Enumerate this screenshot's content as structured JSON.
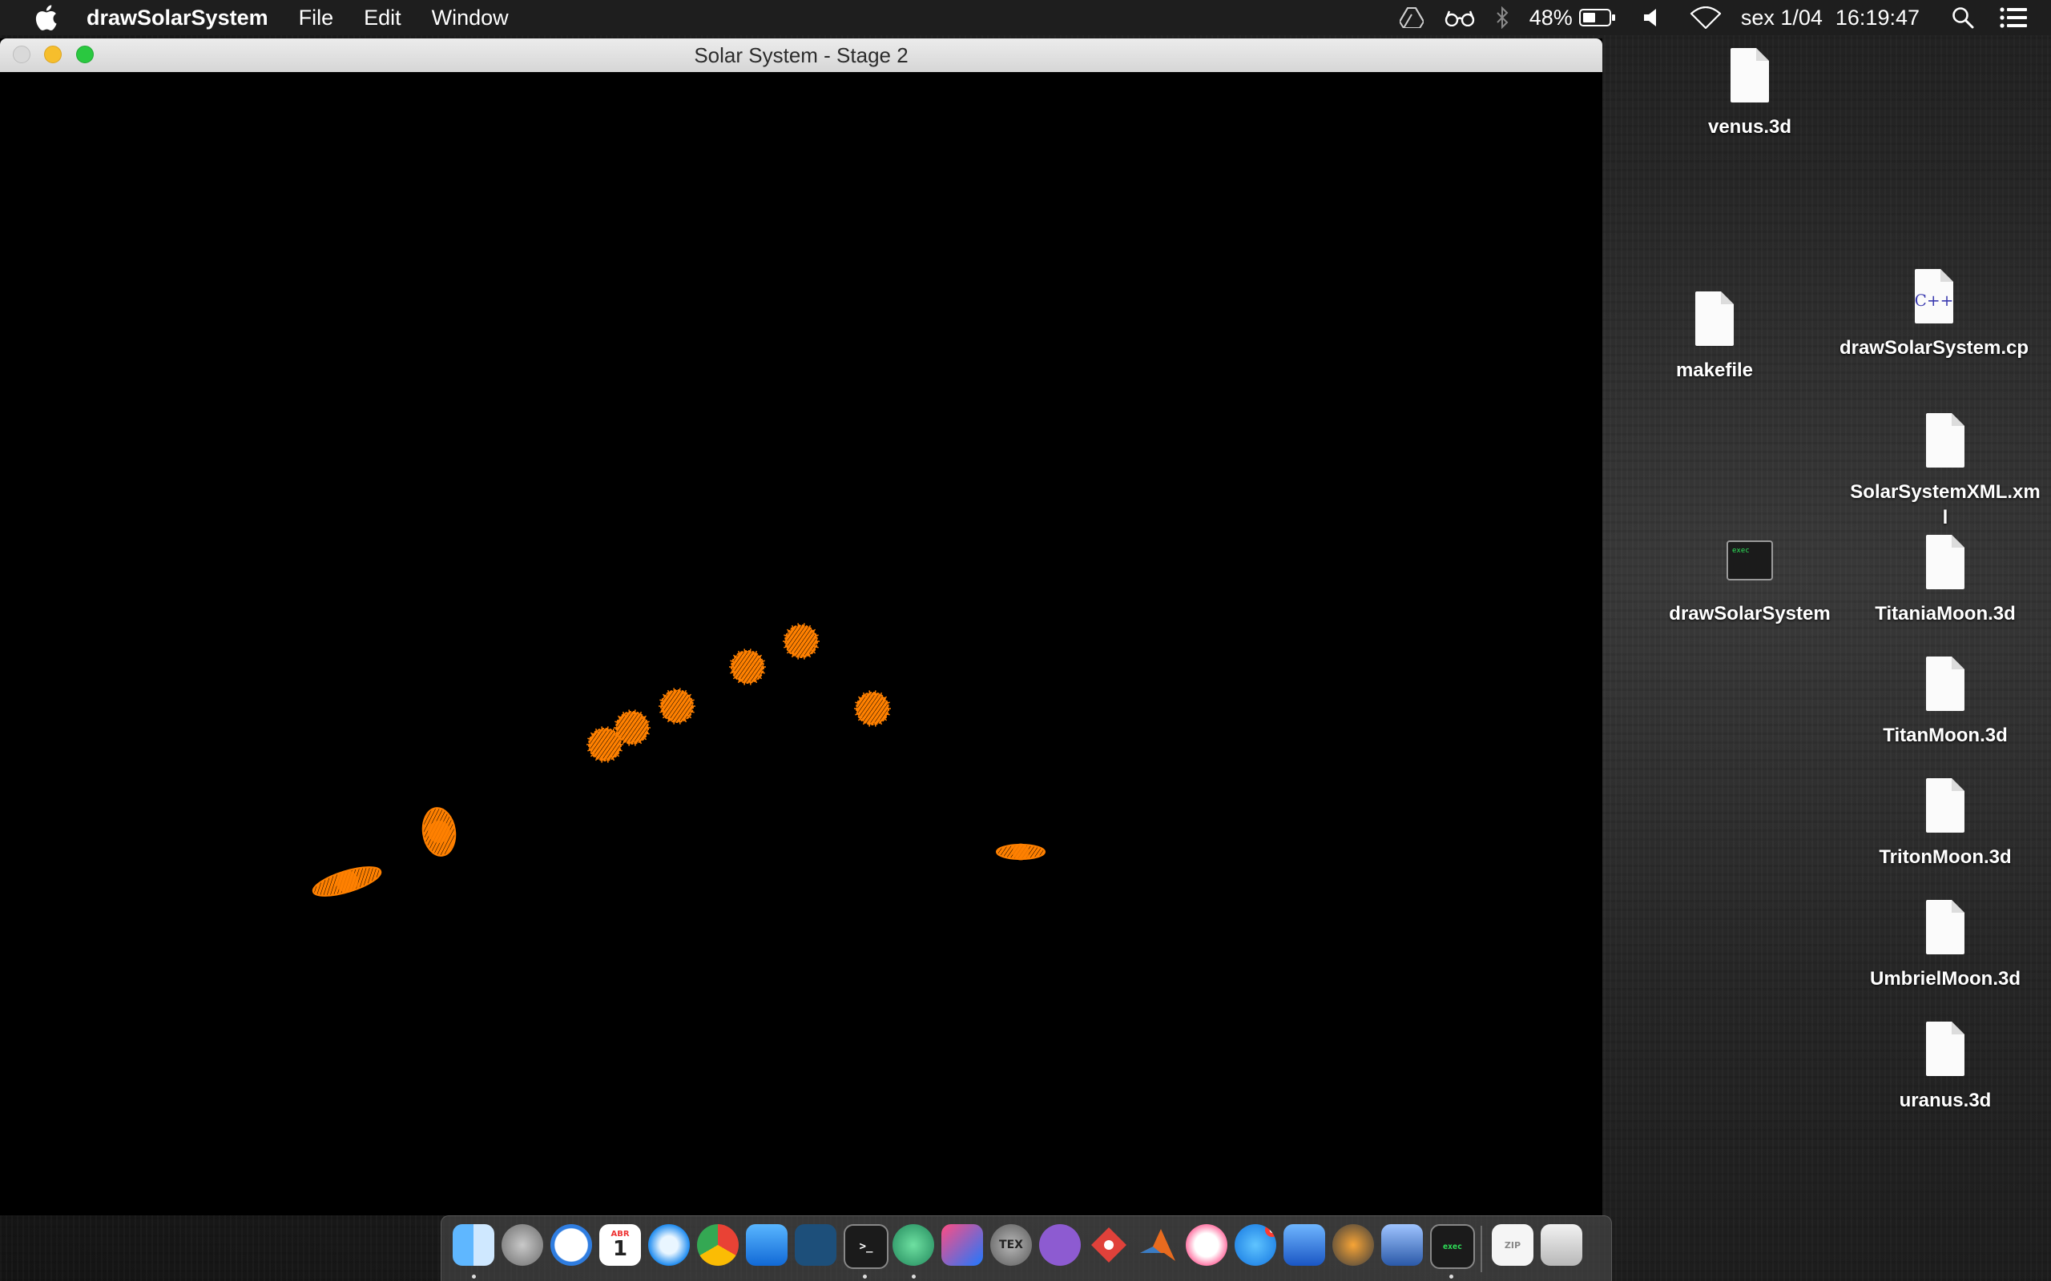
{
  "menubar": {
    "app_name": "drawSolarSystem",
    "items": [
      "File",
      "Edit",
      "Window"
    ],
    "battery_percent": "48%",
    "date": "sex 1/04",
    "time": "16:19:47",
    "icons": [
      "apple-icon",
      "drive-icon",
      "glasses-icon",
      "bluetooth-icon",
      "battery-icon",
      "volume-icon",
      "wifi-icon",
      "spotlight-icon",
      "notification-center-icon"
    ]
  },
  "window": {
    "title": "Solar System - Stage 2",
    "render": {
      "background": "#000000",
      "body_color": "#ff8000",
      "bodies": [
        {
          "kind": "ringed",
          "name": "left-ringed-planet"
        },
        {
          "kind": "ringed-vertical",
          "name": "tilted-planet"
        },
        {
          "kind": "sphere",
          "name": "planet-1"
        },
        {
          "kind": "sphere",
          "name": "planet-2"
        },
        {
          "kind": "sphere",
          "name": "planet-3"
        },
        {
          "kind": "sphere",
          "name": "planet-4"
        },
        {
          "kind": "sphere",
          "name": "planet-5"
        },
        {
          "kind": "sphere",
          "name": "planet-6"
        },
        {
          "kind": "ringed",
          "name": "right-ringed-planet"
        }
      ]
    }
  },
  "desktop": {
    "files": [
      {
        "name": "venus.3d",
        "icon": "document-icon"
      },
      {
        "name": "makefile",
        "icon": "document-icon"
      },
      {
        "name": "drawSolarSystem.cp",
        "icon": "cpp-file-icon"
      },
      {
        "name": "SolarSystemXML.xml",
        "icon": "document-icon"
      },
      {
        "name": "drawSolarSystem",
        "icon": "executable-icon"
      },
      {
        "name": "TitaniaMoon.3d",
        "icon": "document-icon"
      },
      {
        "name": "TitanMoon.3d",
        "icon": "document-icon"
      },
      {
        "name": "TritonMoon.3d",
        "icon": "document-icon"
      },
      {
        "name": "UmbrielMoon.3d",
        "icon": "document-icon"
      },
      {
        "name": "uranus.3d",
        "icon": "document-icon"
      }
    ]
  },
  "dock": {
    "apps": [
      {
        "name": "Finder",
        "icon": "finder-icon",
        "running": true
      },
      {
        "name": "Launchpad",
        "icon": "launchpad-icon",
        "running": false
      },
      {
        "name": "Time Machine",
        "icon": "clock-icon",
        "running": false
      },
      {
        "name": "Calendar",
        "icon": "calendar-icon",
        "running": false,
        "month": "ABR",
        "day": "1"
      },
      {
        "name": "Safari",
        "icon": "safari-icon",
        "running": false
      },
      {
        "name": "Chrome",
        "icon": "chrome-icon",
        "running": false
      },
      {
        "name": "Xcode",
        "icon": "xcode-icon",
        "running": false
      },
      {
        "name": "MySQL Workbench",
        "icon": "dolphin-icon",
        "running": false
      },
      {
        "name": "Terminal",
        "icon": "terminal-icon",
        "running": true
      },
      {
        "name": "Atom",
        "icon": "atom-icon",
        "running": true
      },
      {
        "name": "IntelliJ",
        "icon": "intellij-icon",
        "running": false
      },
      {
        "name": "TeX",
        "icon": "tex-icon",
        "running": false,
        "text": "TEX"
      },
      {
        "name": "GitHub",
        "icon": "github-icon",
        "running": false
      },
      {
        "name": "Git Client",
        "icon": "git-diamond-icon",
        "running": false
      },
      {
        "name": "MATLAB",
        "icon": "matlab-icon",
        "running": false
      },
      {
        "name": "iTunes",
        "icon": "music-icon",
        "running": false
      },
      {
        "name": "App Store",
        "icon": "appstore-icon",
        "running": false,
        "badge": "6"
      },
      {
        "name": "Wireshark",
        "icon": "wireshark-icon",
        "running": false
      },
      {
        "name": "XQuartz",
        "icon": "xquartz-icon",
        "running": false
      },
      {
        "name": "VirtualBox",
        "icon": "virtualbox-icon",
        "running": false
      },
      {
        "name": "drawSolarSystem",
        "icon": "exec-icon",
        "running": true
      },
      {
        "name": "Archive",
        "icon": "zip-icon",
        "running": false
      },
      {
        "name": "Trash",
        "icon": "trash-icon",
        "running": false
      }
    ]
  }
}
